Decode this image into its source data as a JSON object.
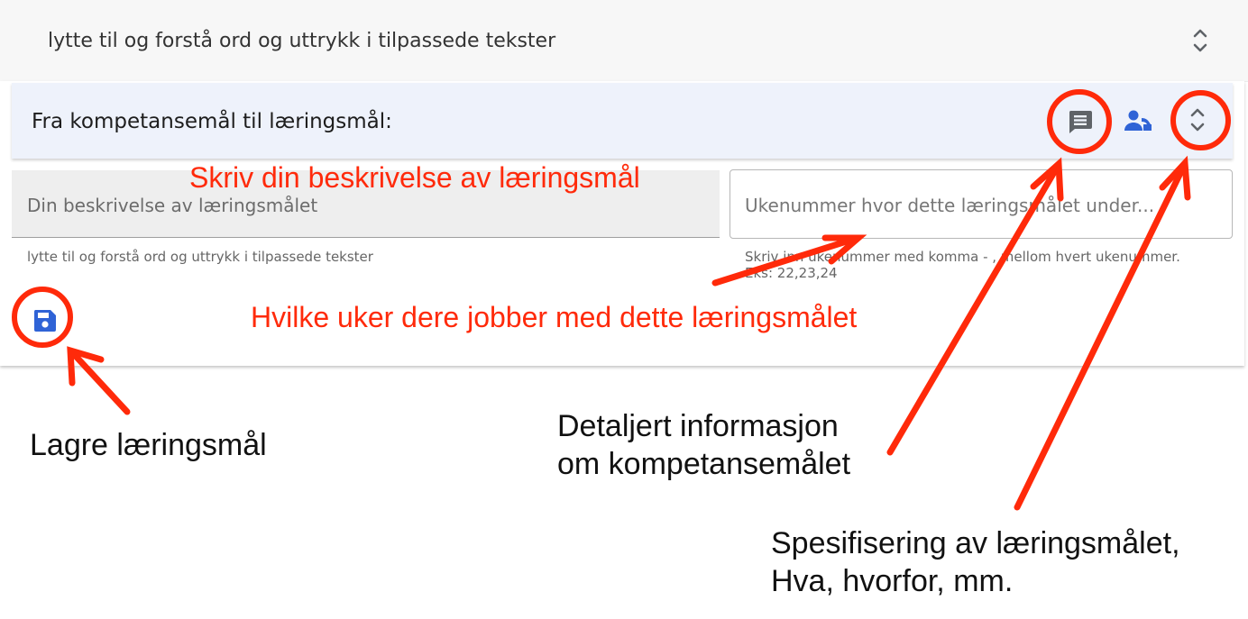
{
  "top_row": {
    "title": "lytte til og forstå ord og uttrykk i tilpassede tekster"
  },
  "panel": {
    "title": "Fra kompetansemål til læringsmål:",
    "description_field": {
      "placeholder": "Din beskrivelse av læringsmålet"
    },
    "description_help": "lytte til og forstå ord og uttrykk i tilpassede tekster",
    "week_field": {
      "placeholder": "Ukenummer hvor dette læringsmålet under..."
    },
    "week_help_line1": "Skriv inn ukenummer med komma - , mellom hvert ukenummer.",
    "week_help_line2": "Eks: 22,23,24"
  },
  "header_icons": [
    "comment-icon",
    "person-icon",
    "expand-icon"
  ],
  "annotations": {
    "describe": "Skriv din beskrivelse av læringsmål",
    "weeks": "Hvilke uker dere jobber med dette læringsmålet",
    "save": "Lagre læringsmål",
    "details_line1": "Detaljert informasjon",
    "details_line2": "om kompetansemålet",
    "spec_line1": "Spesifisering av læringsmålet,",
    "spec_line2": "Hva, hvorfor, mm."
  },
  "colors": {
    "accent_blue": "#2f63d6",
    "annotation_red": "#ff2a0a",
    "header_bg": "#eef2fb",
    "field_bg": "#eeeeee",
    "icon_grey": "#5f6368"
  }
}
